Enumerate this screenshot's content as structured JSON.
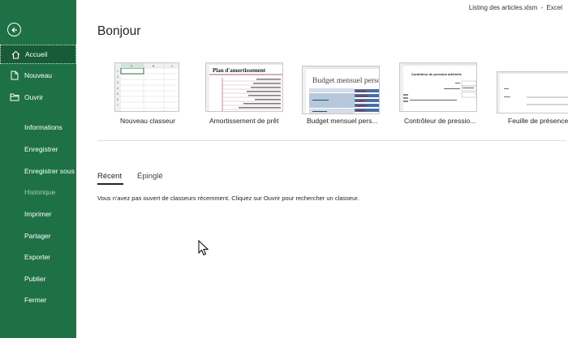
{
  "titlebar": {
    "filename": "Listing des articles.xlsm",
    "separator": "-",
    "app": "Excel"
  },
  "greeting": "Bonjour",
  "nav": {
    "home": "Accueil",
    "new": "Nouveau",
    "open": "Ouvrir",
    "info": "Informations",
    "save": "Enregistrer",
    "save_as": "Enregistrer sous",
    "history": "Historique",
    "print": "Imprimer",
    "share": "Partager",
    "export": "Exporter",
    "publish": "Publier",
    "close": "Fermer"
  },
  "templates": [
    {
      "label": "Nouveau classeur"
    },
    {
      "label": "Amortissement de prêt",
      "thumb_title": "Plan d'amortissement"
    },
    {
      "label": "Budget mensuel pers...",
      "thumb_title": "Budget mensuel perso"
    },
    {
      "label": "Contrôleur de pressio...",
      "thumb_title": "Contrôleur de pression artérielle"
    },
    {
      "label": "Feuille de présence"
    }
  ],
  "tabs": {
    "recent": "Récent",
    "pinned": "Épinglé"
  },
  "empty_message": "Vous n'avez pas ouvert de classeurs récemment. Cliquez sur Ouvrir pour rechercher un classeur.",
  "colors": {
    "sidebar": "#1e7145",
    "sidebar_active": "#185c37",
    "accent": "#217346"
  },
  "icons": {
    "back": "back-arrow-icon",
    "home": "home-icon",
    "new": "new-document-icon",
    "open": "folder-icon",
    "cursor": "mouse-pointer-icon"
  }
}
